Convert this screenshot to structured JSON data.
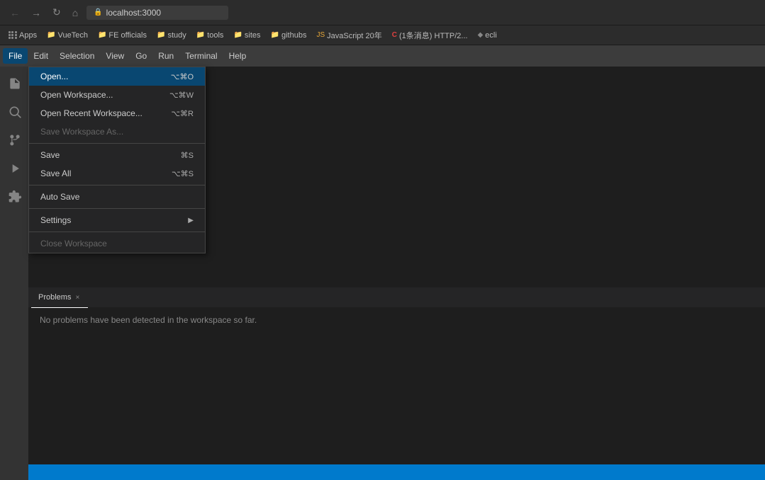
{
  "browser": {
    "url": "localhost:3000",
    "back_btn": "←",
    "forward_btn": "→",
    "refresh_btn": "↻",
    "home_btn": "⌂"
  },
  "bookmarks": {
    "apps_label": "Apps",
    "items": [
      {
        "label": "VueTech",
        "type": "folder"
      },
      {
        "label": "FE officials",
        "type": "folder"
      },
      {
        "label": "study",
        "type": "folder"
      },
      {
        "label": "tools",
        "type": "folder"
      },
      {
        "label": "sites",
        "type": "folder"
      },
      {
        "label": "githubs",
        "type": "folder"
      },
      {
        "label": "JavaScript 20年",
        "type": "link"
      },
      {
        "label": "(1条消息) HTTP/2...",
        "type": "link"
      },
      {
        "label": "ecli",
        "type": "link"
      }
    ]
  },
  "menubar": {
    "items": [
      "File",
      "Edit",
      "Selection",
      "View",
      "Go",
      "Run",
      "Terminal",
      "Help"
    ]
  },
  "file_menu": {
    "items": [
      {
        "label": "Open...",
        "shortcut": "⌥⌘O",
        "disabled": false,
        "highlighted": true,
        "has_arrow": false
      },
      {
        "label": "Open Workspace...",
        "shortcut": "⌥⌘W",
        "disabled": false,
        "highlighted": false,
        "has_arrow": false
      },
      {
        "label": "Open Recent Workspace...",
        "shortcut": "⌥⌘R",
        "disabled": false,
        "highlighted": false,
        "has_arrow": false
      },
      {
        "label": "Save Workspace As...",
        "shortcut": "",
        "disabled": true,
        "highlighted": false,
        "has_arrow": false
      },
      {
        "separator": true
      },
      {
        "label": "Save",
        "shortcut": "⌘S",
        "disabled": false,
        "highlighted": false,
        "has_arrow": false
      },
      {
        "label": "Save All",
        "shortcut": "⌥⌘S",
        "disabled": false,
        "highlighted": false,
        "has_arrow": false
      },
      {
        "separator": true
      },
      {
        "label": "Auto Save",
        "shortcut": "",
        "disabled": false,
        "highlighted": false,
        "has_arrow": false
      },
      {
        "separator": true
      },
      {
        "label": "Settings",
        "shortcut": "",
        "disabled": false,
        "highlighted": false,
        "has_arrow": true
      },
      {
        "separator": true
      },
      {
        "label": "Close Workspace",
        "shortcut": "",
        "disabled": true,
        "highlighted": false,
        "has_arrow": false
      }
    ]
  },
  "panel": {
    "tab_label": "Problems",
    "tab_close": "×",
    "message": "No problems have been detected in the workspace so far."
  },
  "activity_bar": {
    "icons": [
      {
        "name": "explorer-icon",
        "symbol": "⎘",
        "active": false
      },
      {
        "name": "search-icon",
        "symbol": "🔍",
        "active": false
      },
      {
        "name": "source-control-icon",
        "symbol": "⎇",
        "active": false
      },
      {
        "name": "run-icon",
        "symbol": "▷",
        "active": false
      },
      {
        "name": "extensions-icon",
        "symbol": "⊞",
        "active": false
      }
    ]
  }
}
